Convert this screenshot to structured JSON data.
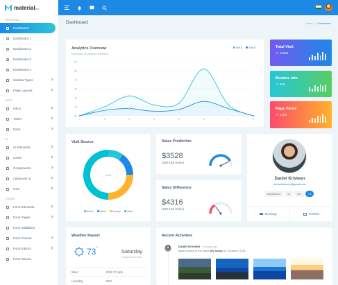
{
  "brand": {
    "name": "material",
    "suffix": "pro"
  },
  "sidebar": {
    "sections": [
      {
        "label": "PERSONAL",
        "items": [
          {
            "label": "Dashboard",
            "active": true,
            "icon": "gauge-icon",
            "chevron": true
          },
          {
            "label": "Dashboard 1",
            "icon": "dot-icon"
          },
          {
            "label": "Dashboard 2",
            "icon": "dot-icon"
          },
          {
            "label": "Dashboard 3",
            "icon": "dot-icon"
          },
          {
            "label": "Dashboard 4",
            "icon": "dot-icon"
          },
          {
            "label": "Sidebar Types",
            "icon": "sidebar-icon",
            "chevron": true
          },
          {
            "label": "Page Layouts",
            "icon": "layout-icon",
            "chevron": true
          }
        ]
      },
      {
        "label": "APPS",
        "items": [
          {
            "label": "Inbox",
            "icon": "inbox-icon",
            "chevron": true
          },
          {
            "label": "Ticket",
            "icon": "ticket-icon",
            "chevron": true
          },
          {
            "label": "Extra",
            "icon": "extra-icon",
            "chevron": true
          }
        ]
      },
      {
        "label": "UI",
        "items": [
          {
            "label": "UI Elements",
            "icon": "grid-icon",
            "chevron": true
          },
          {
            "label": "Cards",
            "icon": "cards-icon",
            "chevron": true
          },
          {
            "label": "Components",
            "icon": "components-icon",
            "chevron": true
          },
          {
            "label": "Advanced UI",
            "icon": "advanced-icon",
            "chevron": true
          },
          {
            "label": "CSS",
            "icon": "css-icon",
            "chevron": true
          }
        ]
      },
      {
        "label": "FORMS",
        "items": [
          {
            "label": "Form Elements",
            "icon": "form-icon",
            "chevron": true
          },
          {
            "label": "Form Pages",
            "icon": "form-pages-icon",
            "chevron": true
          },
          {
            "label": "Form Validation",
            "icon": "validation-icon"
          },
          {
            "label": "Form Pickers",
            "icon": "pickers-icon",
            "chevron": true
          },
          {
            "label": "Form Editors",
            "icon": "editors-icon",
            "chevron": true
          },
          {
            "label": "Form Wizard",
            "icon": "wizard-icon"
          }
        ]
      }
    ]
  },
  "header": {
    "title": "Dashboard",
    "breadcrumb": [
      "Home",
      "Dashboard"
    ]
  },
  "analytics": {
    "title": "Analytics Overview",
    "subtitle": "Overview of Monthly analytics",
    "legend": [
      "Site A",
      "Site B"
    ],
    "chart_data": {
      "type": "area",
      "x": [
        1,
        2,
        3,
        4,
        5,
        6,
        7,
        8
      ],
      "ylim": [
        0,
        6
      ],
      "yticks": [
        "0k",
        "1k",
        "2k",
        "3k",
        "4k",
        "5k",
        "6k"
      ],
      "series": [
        {
          "name": "Site A",
          "color": "#26c6da",
          "values": [
            0,
            1,
            2.2,
            1.2,
            1.4,
            5.2,
            1.2,
            0
          ]
        },
        {
          "name": "Site B",
          "color": "#1e88e5",
          "values": [
            0,
            0.6,
            0.8,
            0.5,
            0.7,
            1.6,
            0.8,
            0
          ]
        }
      ]
    }
  },
  "tiles": [
    {
      "title": "Total Visit",
      "value": "12456",
      "gradient": [
        "#745af2",
        "#1e88e5"
      ],
      "arrow": "up"
    },
    {
      "title": "Bounce rate",
      "value": "456",
      "gradient": [
        "#26c6da",
        "#55ce63"
      ],
      "arrow": "up"
    },
    {
      "title": "Page Views",
      "value": "2456",
      "gradient": [
        "#fc4b6c",
        "#ffb22b"
      ],
      "arrow": "up"
    }
  ],
  "visit_source": {
    "title": "Visit Source",
    "center": "Visits",
    "legend": [
      "Mobile",
      "Tablet",
      "Desktop",
      "Other"
    ],
    "chart_data": {
      "type": "pie",
      "categories": [
        "Mobile",
        "Tablet",
        "Desktop",
        "Other"
      ],
      "values": [
        10,
        15,
        25,
        50
      ],
      "colors": [
        "#26c6da",
        "#1e88e5",
        "#ffb22b",
        "#00c1d4"
      ]
    }
  },
  "prediction": {
    "title": "Sales Prediction",
    "value": "$3528",
    "sub": "(150-165 Sales)",
    "level": 0.85,
    "color": "#1e88e5"
  },
  "difference": {
    "title": "Sales Difference",
    "value": "$4316",
    "sub": "(150-165 Sales)",
    "level": 0.3,
    "color": "#fc4b6c"
  },
  "profile": {
    "name": "Daniel Kristeen",
    "email": "danielkristeen@gmail.com",
    "tags": [
      "Dashboard",
      "UI",
      "UX",
      "+9"
    ],
    "actions": [
      "Message",
      "Portfolio"
    ]
  },
  "weather": {
    "title": "Weather Report",
    "temp": "73",
    "unit": "°",
    "day": "Saturday",
    "desc": "Thunderstorm Here",
    "rows": [
      {
        "label": "Wind",
        "value": "ESE 17 mph"
      },
      {
        "label": "Humidity",
        "value": "83%"
      }
    ]
  },
  "activities": {
    "title": "Recent Activities",
    "items": [
      {
        "name": "Daniel Kristeen",
        "time": "5 minutes ago",
        "text": "added photos to the album",
        "album": "My Snaps",
        "date": "on 14 March, 2018"
      }
    ]
  }
}
